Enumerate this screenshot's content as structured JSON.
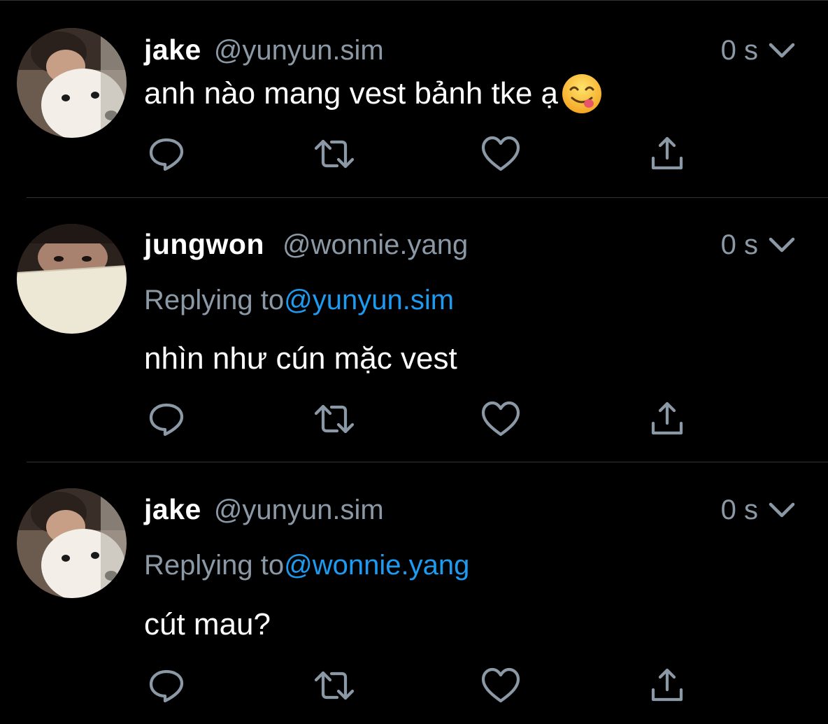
{
  "tweets": [
    {
      "name": "jake",
      "handle": "@yunyun.sim",
      "time": "0 s",
      "reply_prefix": "",
      "reply_to": "",
      "text": "anh nào mang vest bảnh tke ạ",
      "emoji": "face-savoring-food-emoji",
      "avatar": "dog-selfie-avatar"
    },
    {
      "name": "jungwon",
      "handle": "@wonnie.yang",
      "time": "0 s",
      "reply_prefix": "Replying to",
      "reply_to": "@yunyun.sim",
      "text": "nhìn như cún mặc vest",
      "avatar": "covered-face-avatar"
    },
    {
      "name": "jake",
      "handle": "@yunyun.sim",
      "time": "0 s",
      "reply_prefix": "Replying to",
      "reply_to": "@wonnie.yang",
      "text": "cút mau?",
      "avatar": "dog-selfie-avatar"
    }
  ],
  "icons": {
    "reply": "reply-bubble-icon",
    "retweet": "retweet-icon",
    "like": "heart-icon",
    "share": "share-icon",
    "menu": "chevron-down-icon"
  },
  "colors": {
    "background": "#000000",
    "secondary_text": "#8b98a5",
    "link": "#1d9bf0",
    "divider": "#2f3336"
  }
}
